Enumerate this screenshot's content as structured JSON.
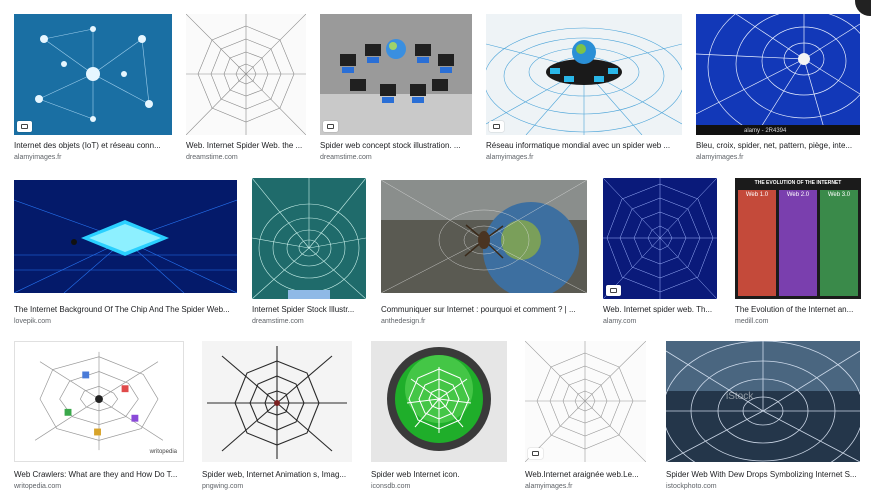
{
  "results": [
    {
      "title": "Internet des objets (IoT) et réseau conn...",
      "source": "alamyimages.fr"
    },
    {
      "title": "Web. Internet Spider Web. the ...",
      "source": "dreamstime.com"
    },
    {
      "title": "Spider web concept stock illustration. ...",
      "source": "dreamstime.com"
    },
    {
      "title": "Réseau informatique mondial avec un spider web ...",
      "source": "alamyimages.fr"
    },
    {
      "title": "Bleu, croix, spider, net, pattern, piège, inte...",
      "source": "alamyimages.fr"
    },
    {
      "title": "The Internet Background Of The Chip And The Spider Web...",
      "source": "lovepik.com"
    },
    {
      "title": "Internet Spider Stock Illustr...",
      "source": "dreamstime.com"
    },
    {
      "title": "Communiquer sur Internet : pourquoi et comment ? | ...",
      "source": "anthedesign.fr"
    },
    {
      "title": "Web. Internet spider web. Th...",
      "source": "alamy.com"
    },
    {
      "title": "The Evolution of the Internet an...",
      "source": "medill.com"
    },
    {
      "title": "Web Crawlers: What are they and How Do T...",
      "source": "writopedia.com"
    },
    {
      "title": "Spider web, Internet Animation s, Imag...",
      "source": "pngwing.com"
    },
    {
      "title": "Spider web Internet icon.",
      "source": "iconsdb.com"
    },
    {
      "title": "Web.Internet araignée web.Le...",
      "source": "alamyimages.fr"
    },
    {
      "title": "Spider Web With Dew Drops Symbolizing Internet S...",
      "source": "istockphoto.com"
    }
  ],
  "thumb_overlays": {
    "r5": "alamy - 2R4394",
    "r10_title": "THE EVOLUTION OF THE INTERNET",
    "r10_cols": [
      "Web 1.0",
      "Web 2.0",
      "Web 3.0"
    ],
    "r14_watermark": "iStock",
    "r11_logo": "writopedia"
  }
}
